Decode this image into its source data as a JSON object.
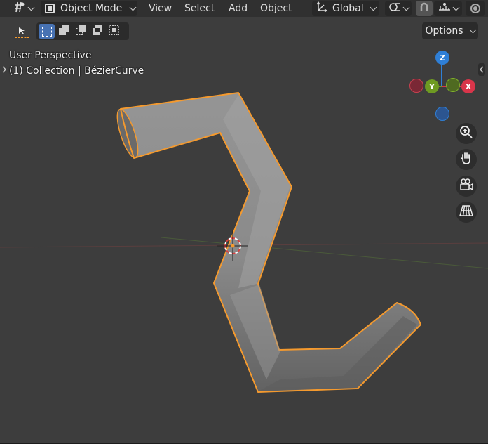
{
  "header": {
    "editor_type_icon": "viewport-editor-icon",
    "mode_label": "Object Mode",
    "menus": [
      "View",
      "Select",
      "Add",
      "Object"
    ],
    "orientation_label": "Global",
    "options_label": "Options"
  },
  "viewport": {
    "view_name": "User Perspective",
    "collection_line": "(1) Collection | BézierCurve"
  },
  "gizmo": {
    "z_label": "Z",
    "y_label": "Y",
    "x_label": "X"
  },
  "colors": {
    "axis_x": "#d9354a",
    "axis_y": "#6e9a22",
    "axis_z": "#2f7fd6",
    "selection_outline": "#f59a2e",
    "header_bg": "#303030",
    "viewport_bg": "#3d3d3d",
    "select_active": "#4772b3"
  },
  "icons": {
    "select_cursor": "cursor-arrow-icon",
    "select_new": "select-new-icon",
    "select_extend": "select-extend-icon",
    "select_subtract": "select-subtract-icon",
    "select_difference": "select-difference-icon",
    "select_intersect": "select-intersect-icon",
    "zoom": "zoom-icon",
    "pan": "hand-icon",
    "camera": "camera-icon",
    "perspective": "perspective-grid-icon"
  }
}
